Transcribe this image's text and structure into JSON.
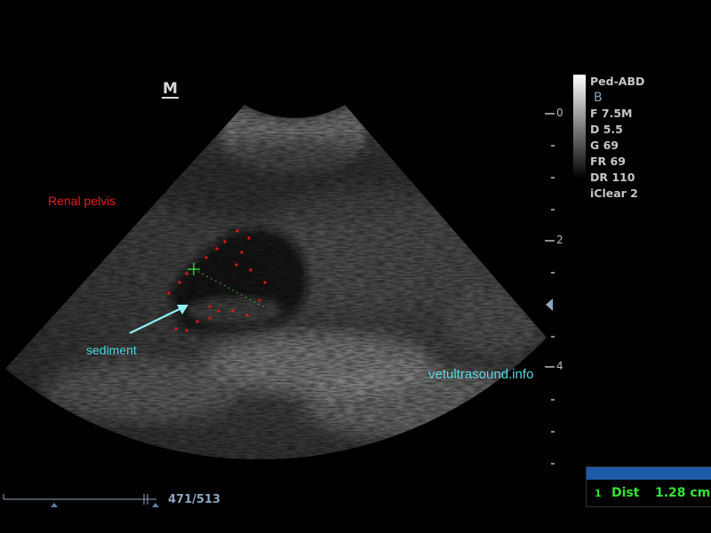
{
  "image": {
    "description_free": true,
    "orientation_marker": "M",
    "labels": {
      "structure": "Renal pelvis",
      "finding": "sediment",
      "watermark": "vetultrasound.info"
    }
  },
  "scan_params": {
    "preset": "Ped-ABD",
    "mode": "B",
    "frequency": "F 7.5M",
    "depth": "D 5.5",
    "gain": "G 69",
    "frame_rate": "FR 69",
    "dynamic_range": "DR 110",
    "iclear": "iClear 2"
  },
  "depth_scale": {
    "labels": [
      "0",
      "2",
      "4"
    ]
  },
  "measurement": {
    "index": "1",
    "label": "Dist",
    "value": "1.28 cm"
  },
  "cine": {
    "frame_counter": "471/513",
    "position": 0.918
  },
  "colors": {
    "label_red": "#e0201c",
    "label_cyan": "#4fd6e0",
    "caliper_green": "#37e337",
    "measure_bar": "#1d5aa8"
  }
}
